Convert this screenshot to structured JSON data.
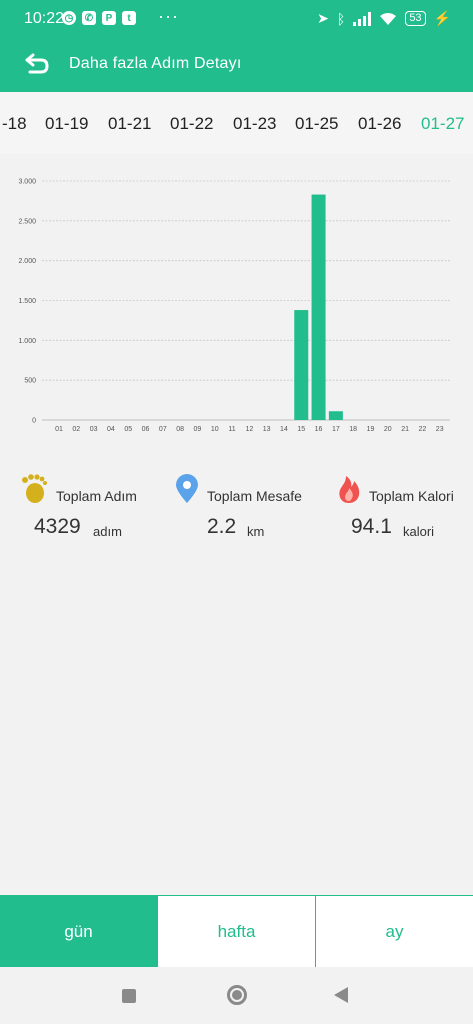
{
  "status_bar": {
    "time": "10:22",
    "notification_icons": [
      "alarm-icon",
      "whatsapp-icon",
      "paypal-icon",
      "twitter-icon"
    ],
    "overflow": "···",
    "battery": "53"
  },
  "header": {
    "title": "Daha fazla Adım Detayı"
  },
  "dates": [
    "-18",
    "01-19",
    "01-21",
    "01-22",
    "01-23",
    "01-25",
    "01-26",
    "01-27"
  ],
  "selected_date": "01-27",
  "chart_data": {
    "type": "bar",
    "categories": [
      "01",
      "02",
      "03",
      "04",
      "05",
      "06",
      "07",
      "08",
      "09",
      "10",
      "11",
      "12",
      "13",
      "14",
      "15",
      "16",
      "17",
      "18",
      "19",
      "20",
      "21",
      "22",
      "23"
    ],
    "values": [
      0,
      0,
      0,
      0,
      0,
      0,
      0,
      0,
      0,
      0,
      0,
      0,
      0,
      0,
      1380,
      2830,
      110,
      0,
      0,
      0,
      0,
      0,
      0
    ],
    "yticks": [
      "0",
      "500",
      "1.000",
      "1.500",
      "2.000",
      "2.500",
      "3.000"
    ],
    "ylim": [
      0,
      3000
    ],
    "grid": true,
    "color": "#21bd8c"
  },
  "stats": {
    "steps": {
      "label": "Toplam Adım",
      "value": "4329",
      "unit": "adım"
    },
    "distance": {
      "label": "Toplam Mesafe",
      "value": "2.2",
      "unit": "km"
    },
    "calories": {
      "label": "Toplam Kalori",
      "value": "94.1",
      "unit": "kalori"
    }
  },
  "tabs": [
    {
      "label": "gün",
      "active": true
    },
    {
      "label": "hafta",
      "active": false
    },
    {
      "label": "ay",
      "active": false
    }
  ],
  "colors": {
    "accent": "#21bd8c",
    "distance_icon": "#5aa3ea",
    "calorie_icon": "#f0524f",
    "steps_icon": "#d4b11c"
  }
}
